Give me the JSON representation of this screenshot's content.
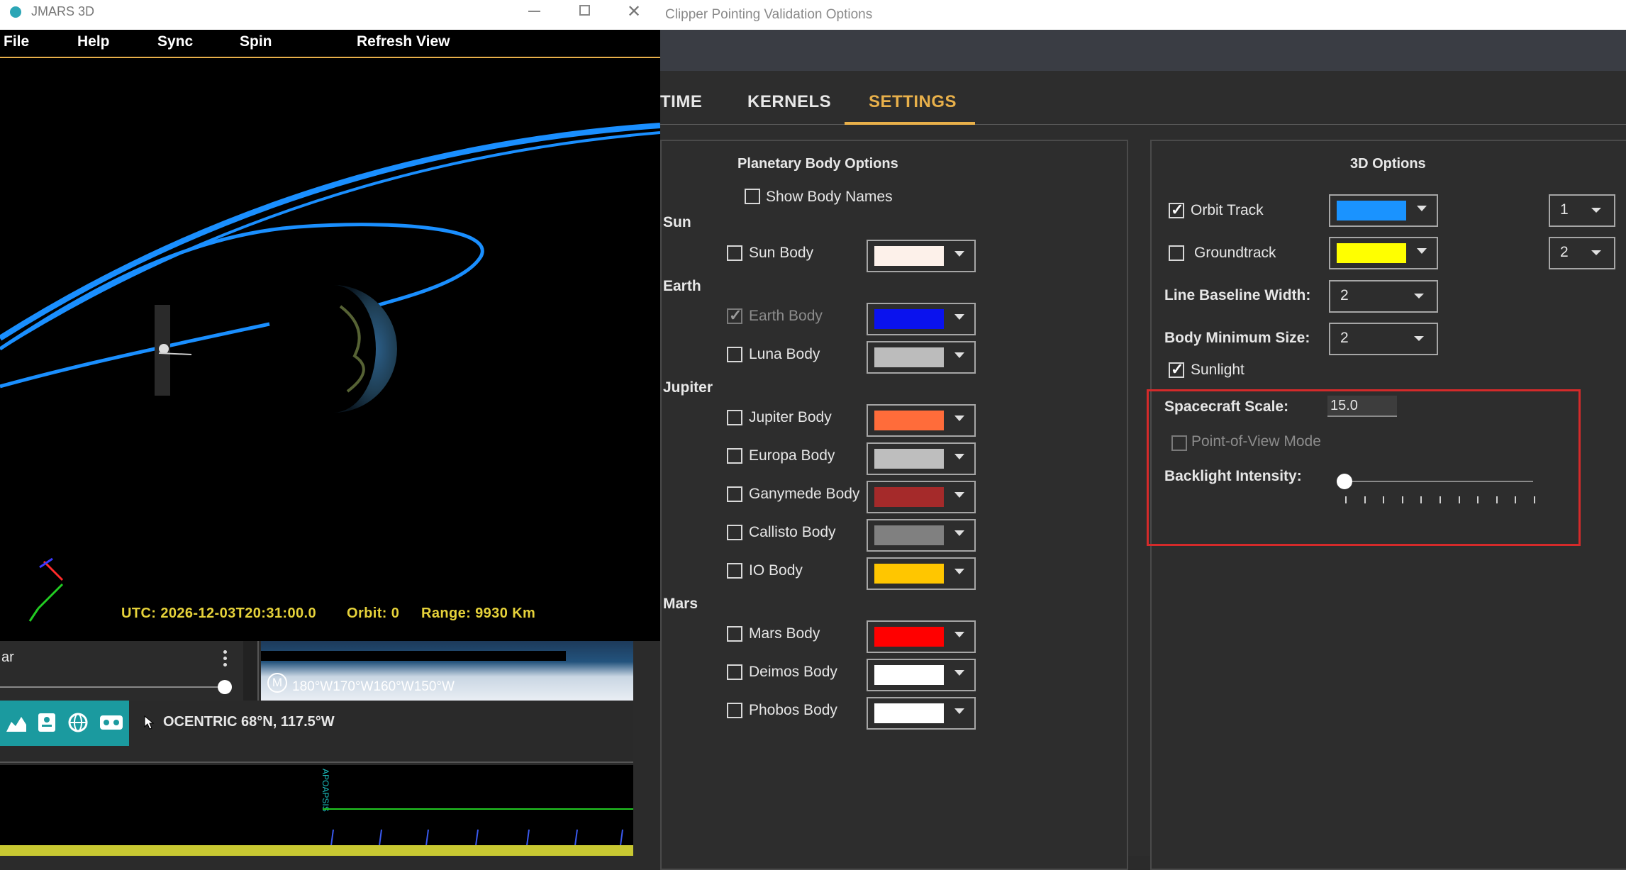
{
  "options_window": {
    "title": "Clipper Pointing Validation Options",
    "tabs": [
      {
        "label": "TIME"
      },
      {
        "label": "KERNELS"
      },
      {
        "label": "SETTINGS"
      }
    ],
    "planetary": {
      "title": "Planetary Body Options",
      "show_body_names": "Show Body Names",
      "groups": {
        "sun": "Sun",
        "earth": "Earth",
        "jupiter": "Jupiter",
        "mars": "Mars"
      },
      "bodies": [
        {
          "label": "Sun Body",
          "color": "#fdf1ea",
          "checked": false,
          "enabled": true
        },
        {
          "label": "Earth Body",
          "color": "#0a12ee",
          "checked": true,
          "enabled": false
        },
        {
          "label": "Luna Body",
          "color": "#bcbcbc",
          "checked": false,
          "enabled": true
        },
        {
          "label": "Jupiter Body",
          "color": "#ff6c3a",
          "checked": false,
          "enabled": true
        },
        {
          "label": "Europa Body",
          "color": "#bebebe",
          "checked": false,
          "enabled": true
        },
        {
          "label": "Ganymede Body",
          "color": "#a52a2a",
          "checked": false,
          "enabled": true
        },
        {
          "label": "Callisto Body",
          "color": "#808080",
          "checked": false,
          "enabled": true
        },
        {
          "label": "IO Body",
          "color": "#ffc600",
          "checked": false,
          "enabled": true
        },
        {
          "label": "Mars Body",
          "color": "#ff0000",
          "checked": false,
          "enabled": true
        },
        {
          "label": "Deimos Body",
          "color": "#ffffff",
          "checked": false,
          "enabled": true
        },
        {
          "label": "Phobos Body",
          "color": "#ffffff",
          "checked": false,
          "enabled": true
        }
      ]
    },
    "options3d": {
      "title": "3D Options",
      "orbit_track": {
        "label": "Orbit Track",
        "checked": true,
        "color": "#1a93ff",
        "width": "1"
      },
      "groundtrack": {
        "label": "Groundtrack",
        "checked": false,
        "color": "#ffff00",
        "width": "2"
      },
      "line_baseline_width": {
        "label": "Line Baseline Width:",
        "value": "2"
      },
      "body_min_size": {
        "label": "Body Minimum Size:",
        "value": "2"
      },
      "sunlight": {
        "label": "Sunlight",
        "checked": true
      },
      "spacecraft_scale": {
        "label": "Spacecraft Scale:",
        "value": "15.0"
      },
      "pov_mode": {
        "label": "Point-of-View Mode",
        "checked": false,
        "enabled": false
      },
      "backlight": {
        "label": "Backlight Intensity:",
        "value": 0
      }
    }
  },
  "jmars_window": {
    "title": "JMARS 3D",
    "menu": [
      "File",
      "Help",
      "Sync",
      "Spin",
      "Refresh View"
    ],
    "status": {
      "utc": "UTC: 2026-12-03T20:31:00.0",
      "orbit": "Orbit:  0",
      "range": "Range: 9930 Km"
    }
  },
  "main_app": {
    "layer_name": "ar",
    "map_marker": "M",
    "map_scale": "180°W170°W160°W150°W",
    "coords_label": "OCENTRIC  68°N, 117.5°W",
    "timeline_marker": "APOAPSIS"
  },
  "colors": {
    "accent": "#e8b04a",
    "highlight": "#d42a2a",
    "teal": "#1b9a9f"
  }
}
